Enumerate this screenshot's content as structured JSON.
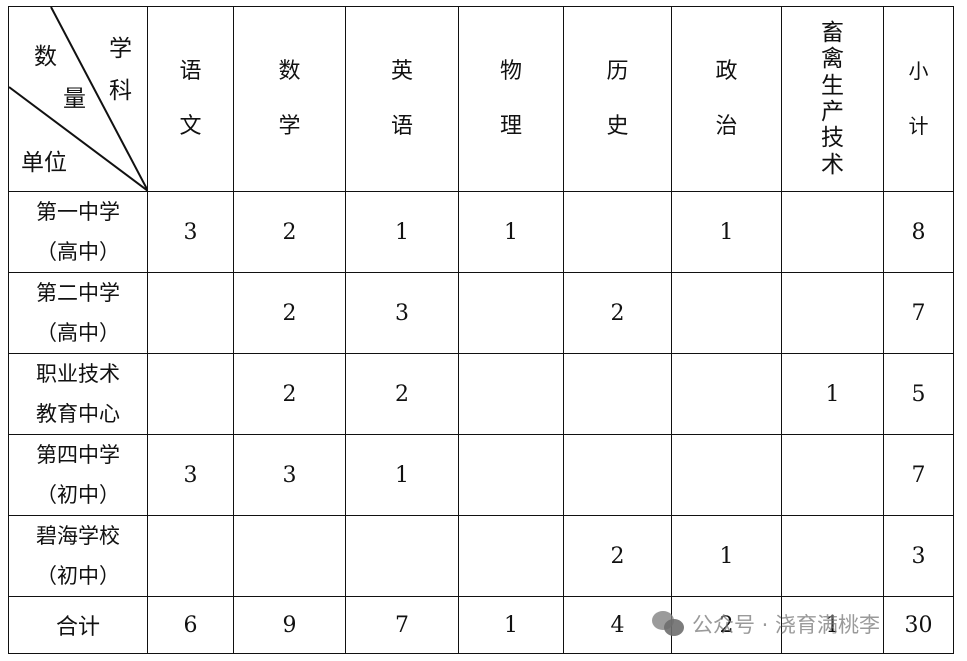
{
  "corner": {
    "subject_label": [
      "学",
      "科"
    ],
    "quantity_label": [
      "数",
      "量"
    ],
    "unit_label": "单位"
  },
  "subjects": [
    "语文",
    "数学",
    "英语",
    "物理",
    "历史",
    "政治",
    "畜禽生产技术",
    "小计"
  ],
  "rows": [
    {
      "unit": [
        "第一中学",
        "（高中）"
      ],
      "values": [
        "3",
        "2",
        "1",
        "1",
        "",
        "1",
        "",
        "8"
      ]
    },
    {
      "unit": [
        "第二中学",
        "（高中）"
      ],
      "values": [
        "",
        "2",
        "3",
        "",
        "2",
        "",
        "",
        "7"
      ]
    },
    {
      "unit": [
        "职业技术",
        "教育中心"
      ],
      "values": [
        "",
        "2",
        "2",
        "",
        "",
        "",
        "1",
        "5"
      ]
    },
    {
      "unit": [
        "第四中学",
        "（初中）"
      ],
      "values": [
        "3",
        "3",
        "1",
        "",
        "",
        "",
        "",
        "7"
      ]
    },
    {
      "unit": [
        "碧海学校",
        "（初中）"
      ],
      "values": [
        "",
        "",
        "",
        "",
        "2",
        "1",
        "",
        "3"
      ]
    }
  ],
  "total": {
    "label": "合计",
    "values": [
      "6",
      "9",
      "7",
      "1",
      "4",
      "2",
      "1",
      "30"
    ]
  },
  "watermark": {
    "text": "公众号 · 浇育满桃李",
    "icon": "wechat-icon"
  }
}
